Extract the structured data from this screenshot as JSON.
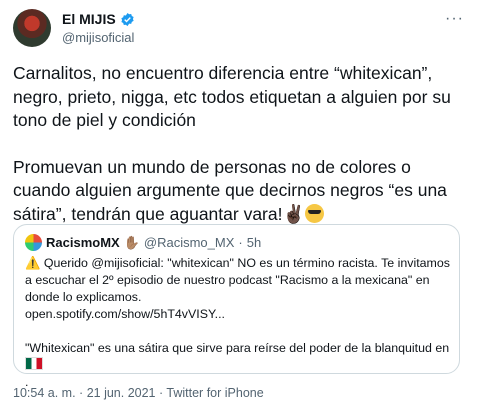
{
  "author": {
    "name": "El MIJIS",
    "handle": "@mijisoficial"
  },
  "more_label": "···",
  "tweet": {
    "paragraph1": "Carnalitos, no encuentro diferencia entre “whitexican”, negro, prieto, nigga, etc todos etiquetan a alguien por su tono de piel y condición",
    "paragraph2": "Promuevan un mundo de personas no de colores o cuando alguien argumente que decirnos negros “es una sátira”, tendrán que aguantar vara!",
    "emoji1": "✌🏿",
    "emoji2": "😎"
  },
  "quote": {
    "name": "RacismoMX",
    "hand_emoji": "✋🏽",
    "handle": "@Racismo_MX",
    "separator": "·",
    "time": "5h",
    "line1": "⚠️ Querido @mijisoficial: \"whitexican\" NO es un término racista. Te invitamos a escuchar el 2º episodio de nuestro podcast \"Racismo a la mexicana\" en donde lo explicamos.",
    "link": "open.spotify.com/show/5hT4vVISY...",
    "line2": "\"Whitexican\" es una sátira que sirve para reírse del poder de la blanquitud en",
    "line2_end": "."
  },
  "footer": {
    "time": "10:54 a. m.",
    "sep": "·",
    "date": "21 jun. 2021",
    "source": "Twitter for iPhone"
  },
  "colors": {
    "verified": "#1d9bf0",
    "secondary": "#536471",
    "border": "#cfd9de"
  }
}
